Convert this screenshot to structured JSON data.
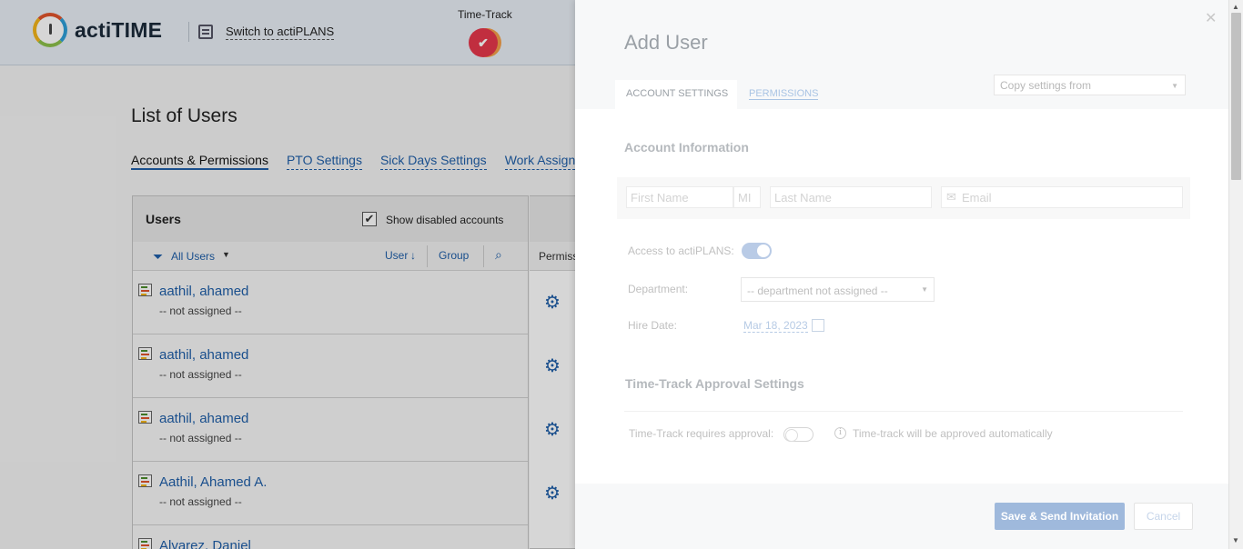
{
  "header": {
    "logo_text": "actiTIME",
    "switch_label": "Switch to actiPLANS",
    "time_track_label": "Time-Track",
    "time_track_badge": "✔"
  },
  "page": {
    "title": "List of Users",
    "tabs": [
      {
        "label": "Accounts & Permissions",
        "active": true
      },
      {
        "label": "PTO Settings"
      },
      {
        "label": "Sick Days Settings"
      },
      {
        "label": "Work Assign"
      }
    ]
  },
  "users_panel": {
    "title": "Users",
    "show_disabled_label": "Show disabled accounts",
    "show_disabled_checked": "✔",
    "filter_label": "All Users",
    "col_user": "User",
    "sort_indicator": "↓",
    "col_group": "Group",
    "permissions_label": "Permiss",
    "rows": [
      {
        "name": "aathil, ahamed",
        "dept": "-- not assigned --"
      },
      {
        "name": "aathil, ahamed",
        "dept": "-- not assigned --"
      },
      {
        "name": "aathil, ahamed",
        "dept": "-- not assigned --"
      },
      {
        "name": "Aathil, Ahamed A.",
        "dept": "-- not assigned --"
      },
      {
        "name": "Alvarez, Daniel",
        "dept": ""
      }
    ]
  },
  "modal": {
    "close": "✕",
    "title": "Add User",
    "tab_account": "ACCOUNT SETTINGS",
    "tab_permissions": "PERMISSIONS",
    "copy_settings_placeholder": "Copy settings from",
    "account_info_title": "Account Information",
    "first_name_placeholder": "First Name",
    "mi_placeholder": "MI",
    "last_name_placeholder": "Last Name",
    "email_placeholder": "Email",
    "access_label": "Access to actiPLANS:",
    "access_on": true,
    "department_label": "Department:",
    "department_value": "-- department not assigned --",
    "hire_date_label": "Hire Date:",
    "hire_date_value": "Mar 18, 2023",
    "approval_title": "Time-Track Approval Settings",
    "approval_label": "Time-Track requires approval:",
    "approval_info": "Time-track will be approved automatically",
    "approval_on": false,
    "save_button": "Save & Send Invitation",
    "cancel_button": "Cancel"
  },
  "colors": {
    "accent": "#1f5fa8",
    "badge": "#e6374c",
    "save_button_disabled": "#9fb9dc"
  }
}
